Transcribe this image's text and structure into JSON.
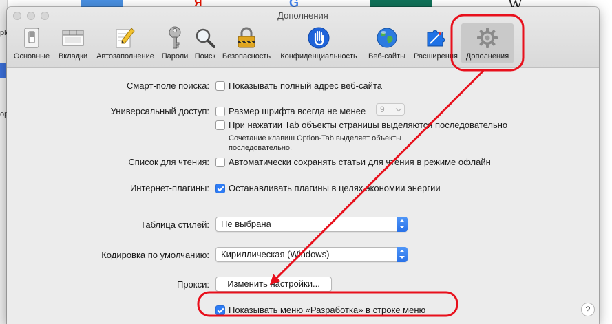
{
  "window": {
    "title": "Дополнения"
  },
  "toolbar": {
    "items": [
      {
        "label": "Основные",
        "icon": "switch-icon"
      },
      {
        "label": "Вкладки",
        "icon": "tabs-window-icon"
      },
      {
        "label": "Автозаполнение",
        "icon": "pencil-icon"
      },
      {
        "label": "Пароли",
        "icon": "key-icon"
      },
      {
        "label": "Поиск",
        "icon": "magnifier-icon"
      },
      {
        "label": "Безопасность",
        "icon": "padlock-icon"
      },
      {
        "label": "Конфиденциальность",
        "icon": "hand-icon"
      },
      {
        "label": "Веб-сайты",
        "icon": "globe-icon"
      },
      {
        "label": "Расширения",
        "icon": "puzzle-icon"
      },
      {
        "label": "Дополнения",
        "icon": "gear-icon",
        "active": true
      }
    ]
  },
  "settings": {
    "smart_search": {
      "label": "Смарт-поле поиска:",
      "option": "Показывать полный адрес веб-сайта",
      "checked": false
    },
    "accessibility": {
      "label": "Универсальный доступ:",
      "option1": "Размер шрифта всегда не менее",
      "font_size_value": "9",
      "option2": "При нажатии Tab объекты страницы выделяются последовательно",
      "hint_line1": "Сочетание клавиш Option-Tab выделяет объекты",
      "hint_line2": "последовательно."
    },
    "reading_list": {
      "label": "Список для чтения:",
      "option": "Автоматически сохранять статьи для чтения в режиме офлайн",
      "checked": false
    },
    "plugins": {
      "label": "Интернет-плагины:",
      "option": "Останавливать плагины в целях экономии энергии",
      "checked": true
    },
    "stylesheet": {
      "label": "Таблица стилей:",
      "value": "Не выбрана"
    },
    "encoding": {
      "label": "Кодировка по умолчанию:",
      "value": "Кириллическая (Windows)"
    },
    "proxy": {
      "label": "Прокси:",
      "button": "Изменить настройки..."
    },
    "develop_menu": {
      "option": "Показывать меню «Разработка» в строке меню",
      "checked": true
    },
    "help": "?"
  },
  "background": {
    "left_text_1": "ple",
    "left_text_2": "op"
  },
  "annotation_colors": {
    "highlight": "#e8101c"
  }
}
